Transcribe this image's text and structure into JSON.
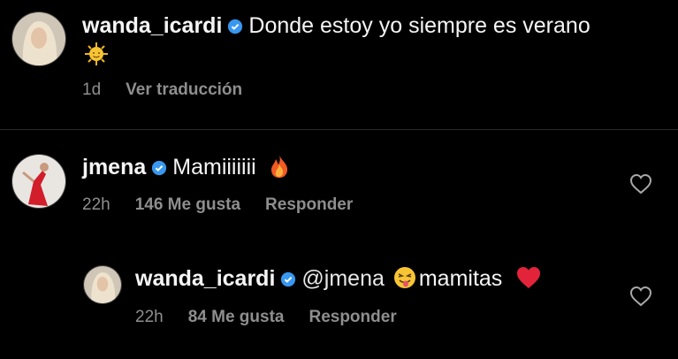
{
  "caption": {
    "username": "wanda_icardi",
    "text": "Donde estoy yo siempre es verano",
    "emoji_icon": "sun-emoji",
    "time": "1d",
    "translate_label": "Ver traducción"
  },
  "comments": [
    {
      "username": "jmena",
      "text": "Mamiiiiiii",
      "emoji_icon": "fire-emoji",
      "time": "22h",
      "likes": "146 Me gusta",
      "reply_label": "Responder"
    },
    {
      "username": "wanda_icardi",
      "mention": "@jmena",
      "text": "mamitas",
      "emoji_icons": [
        "zany-face-emoji",
        "red-heart-emoji"
      ],
      "time": "22h",
      "likes": "84 Me gusta",
      "reply_label": "Responder"
    }
  ],
  "colors": {
    "background": "#000000",
    "text": "#f5f5f5",
    "muted": "#8e8e8e",
    "verified": "#3897f0"
  }
}
